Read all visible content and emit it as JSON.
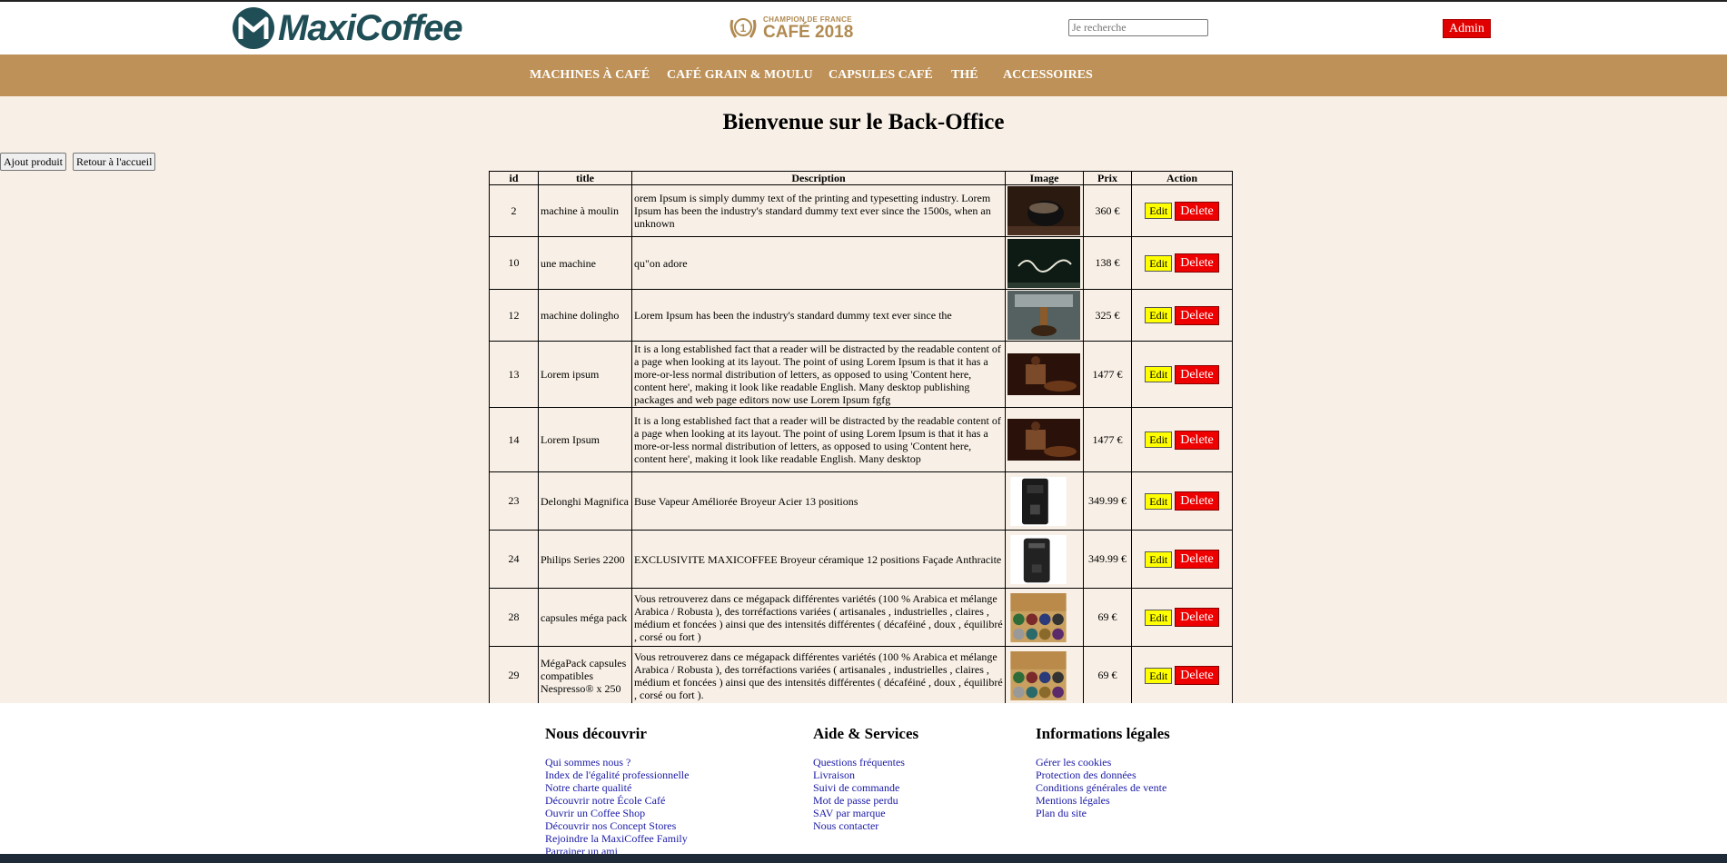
{
  "header": {
    "logo_text": "MaxiCoffee",
    "champion_small": "CHAMPION DE FRANCE",
    "champion_big": "CAFÉ 2018",
    "champion_digit": "1",
    "search_placeholder": "Je recherche",
    "admin_label": "Admin"
  },
  "nav": {
    "items": [
      {
        "label": "MACHINES À CAFÉ"
      },
      {
        "label": "CAFÉ GRAIN & MOULU"
      },
      {
        "label": "CAPSULES CAFÉ"
      },
      {
        "label": "THÉ"
      },
      {
        "label": "ACCESSOIRES"
      }
    ]
  },
  "main": {
    "title": "Bienvenue sur le Back-Office",
    "add_button": "Ajout produit",
    "back_button": "Retour à l'accueil"
  },
  "table": {
    "headers": {
      "id": "id",
      "title": "title",
      "description": "Description",
      "image": "Image",
      "price": "Prix",
      "action": "Action"
    },
    "edit_label": "Edit",
    "delete_label": "Delete",
    "rows": [
      {
        "id": "2",
        "title": "machine à moulin",
        "description": "orem Ipsum is simply dummy text of the printing and typesetting industry. Lorem Ipsum has been the industry's standard dummy text ever since the 1500s, when an unknown",
        "price": "360 €",
        "image": "coffee-grinder-photo"
      },
      {
        "id": "10",
        "title": "une machine",
        "description": "qu\"on adore",
        "price": "138 €",
        "image": "coffeelovers-chalkboard-photo"
      },
      {
        "id": "12",
        "title": "machine dolingho",
        "description": "Lorem Ipsum has been the industry's standard dummy text ever since the",
        "price": "325 €",
        "image": "espresso-pour-photo"
      },
      {
        "id": "13",
        "title": "Lorem ipsum",
        "description": "It is a long established fact that a reader will be distracted by the readable content of a page when looking at its layout. The point of using Lorem Ipsum is that it has a more-or-less normal distribution of letters, as opposed to using 'Content here, content here', making it look like readable English. Many desktop publishing packages and web page editors now use Lorem Ipsum fgfg",
        "price": "1477 €",
        "image": "coffee-grinder-beans-photo"
      },
      {
        "id": "14",
        "title": "Lorem Ipsum",
        "description": "It is a long established fact that a reader will be distracted by the readable content of a page when looking at its layout. The point of using Lorem Ipsum is that it has a more-or-less normal distribution of letters, as opposed to using 'Content here, content here', making it look like readable English. Many desktop",
        "price": "1477 €",
        "image": "coffee-grinder-beans-photo"
      },
      {
        "id": "23",
        "title": "Delonghi Magnifica",
        "description": "Buse Vapeur Améliorée Broyeur Acier 13 positions",
        "price": "349.99 €",
        "image": "delonghi-machine-photo"
      },
      {
        "id": "24",
        "title": "Philips Series 2200",
        "description": "EXCLUSIVITE MAXICOFFEE Broyeur céramique 12 positions Façade Anthracite",
        "price": "349.99 €",
        "image": "philips-machine-photo"
      },
      {
        "id": "28",
        "title": "capsules méga pack",
        "description": "Vous retrouverez dans ce mégapack différentes variétés (100 % Arabica et mélange Arabica / Robusta ), des torréfactions variées ( artisanales , industrielles , claires , médium et foncées ) ainsi que des intensités différentes ( décaféiné , doux , équilibré , corsé ou fort )",
        "price": "69 €",
        "image": "megapack-capsules-photo"
      },
      {
        "id": "29",
        "title": "MégaPack capsules compatibles Nespresso® x 250",
        "description": "Vous retrouverez dans ce mégapack différentes variétés (100 % Arabica et mélange Arabica / Robusta ), des torréfactions variées ( artisanales , industrielles , claires , médium et foncées ) ainsi que des intensités différentes ( décaféiné , doux , équilibré , corsé ou fort ).",
        "price": "69 €",
        "image": "megapack-capsules-photo"
      }
    ]
  },
  "footer": {
    "columns": [
      {
        "title": "Nous découvrir",
        "links": [
          "Qui sommes nous ?",
          "Index de l'égalité professionnelle",
          "Notre charte qualité",
          "Découvrir notre École Café",
          "Ouvrir un Coffee Shop",
          "Découvrir nos Concept Stores",
          "Rejoindre la MaxiCoffee Family",
          "Parrainer un ami"
        ]
      },
      {
        "title": "Aide & Services",
        "links": [
          "Questions fréquentes",
          "Livraison",
          "Suivi de commande",
          "Mot de passe perdu",
          "SAV par marque",
          "Nous contacter"
        ]
      },
      {
        "title": "Informations légales",
        "links": [
          "Gérer les cookies",
          "Protection des données",
          "Conditions générales de vente",
          "Mentions légales",
          "Plan du site"
        ]
      }
    ]
  },
  "colors": {
    "brand_teal": "#1f4e56",
    "nav_tan": "#be9158",
    "page_bg": "#f8f0e6",
    "admin_red": "#e00000",
    "edit_yellow": "#ffff00",
    "delete_red": "#ee0000",
    "link_blue": "#1a1aa6"
  }
}
